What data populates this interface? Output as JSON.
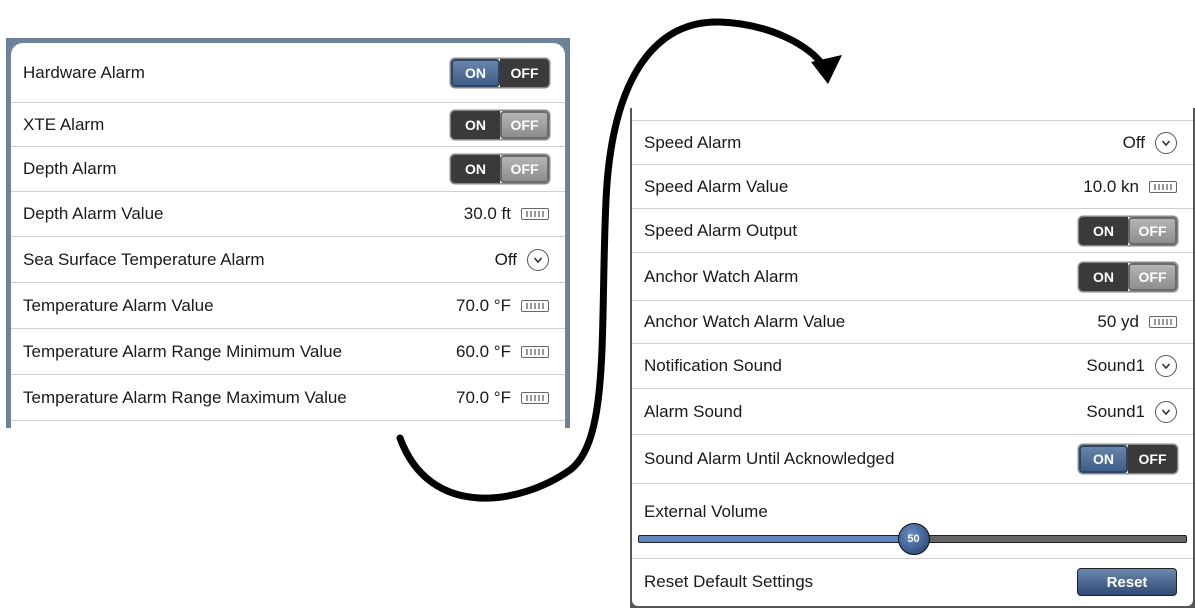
{
  "left_panel": {
    "rows": [
      {
        "label": "Hardware Alarm",
        "toggle": {
          "on": "ON",
          "off": "OFF",
          "state": "on"
        }
      },
      {
        "label": "XTE Alarm",
        "toggle": {
          "on": "ON",
          "off": "OFF",
          "state": "off"
        }
      },
      {
        "label": "Depth Alarm",
        "toggle": {
          "on": "ON",
          "off": "OFF",
          "state": "off"
        }
      },
      {
        "label": "Depth Alarm Value",
        "value": "30.0 ft",
        "icon": "keyboard-icon"
      },
      {
        "label": "Sea Surface Temperature Alarm",
        "value": "Off",
        "icon": "chevron-down-icon"
      },
      {
        "label": "Temperature Alarm Value",
        "value": "70.0 °F",
        "icon": "keyboard-icon"
      },
      {
        "label": "Temperature Alarm Range Minimum Value",
        "value": "60.0 °F",
        "icon": "keyboard-icon"
      },
      {
        "label": "Temperature Alarm Range Maximum Value",
        "value": "70.0 °F",
        "icon": "keyboard-icon"
      }
    ]
  },
  "right_panel": {
    "rows": [
      {
        "label": "Speed Alarm",
        "value": "Off",
        "icon": "chevron-down-icon"
      },
      {
        "label": "Speed Alarm Value",
        "value": "10.0 kn",
        "icon": "keyboard-icon"
      },
      {
        "label": "Speed Alarm Output",
        "toggle": {
          "on": "ON",
          "off": "OFF",
          "state": "off"
        }
      },
      {
        "label": "Anchor Watch Alarm",
        "toggle": {
          "on": "ON",
          "off": "OFF",
          "state": "off"
        }
      },
      {
        "label": "Anchor Watch Alarm Value",
        "value": "50 yd",
        "icon": "keyboard-icon"
      },
      {
        "label": "Notification Sound",
        "value": "Sound1",
        "icon": "chevron-down-icon"
      },
      {
        "label": "Alarm Sound",
        "value": "Sound1",
        "icon": "chevron-down-icon"
      },
      {
        "label": "Sound Alarm Until Acknowledged",
        "toggle": {
          "on": "ON",
          "off": "OFF",
          "state": "on"
        }
      }
    ],
    "volume": {
      "label": "External Volume",
      "value": 50,
      "display": "50",
      "max": 100
    },
    "reset": {
      "label": "Reset Default Settings",
      "button": "Reset"
    }
  },
  "colors": {
    "accent": "#3b5a86",
    "frame": "#6b8299"
  }
}
